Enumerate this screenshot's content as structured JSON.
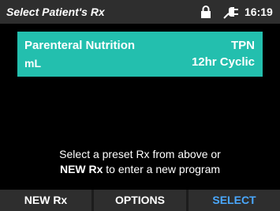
{
  "status_bar": {
    "title": "Select Patient's Rx",
    "time": "16:19",
    "icons": [
      "lock-icon",
      "plug-icon"
    ]
  },
  "rx_list": [
    {
      "name": "Parenteral Nutrition",
      "type": "TPN",
      "unit": "mL",
      "mode": "12hr Cyclic"
    }
  ],
  "instruction": {
    "line1": "Select a preset Rx from above or",
    "line2_bold": "NEW Rx",
    "line2_rest": " to enter a new program"
  },
  "softkeys": {
    "new_rx": "NEW Rx",
    "options": "OPTIONS",
    "select": "SELECT"
  },
  "colors": {
    "accent_card": "#23bfae",
    "select_text": "#4aa8ff",
    "status_bar": "#2e2e2e",
    "background": "#000000"
  }
}
